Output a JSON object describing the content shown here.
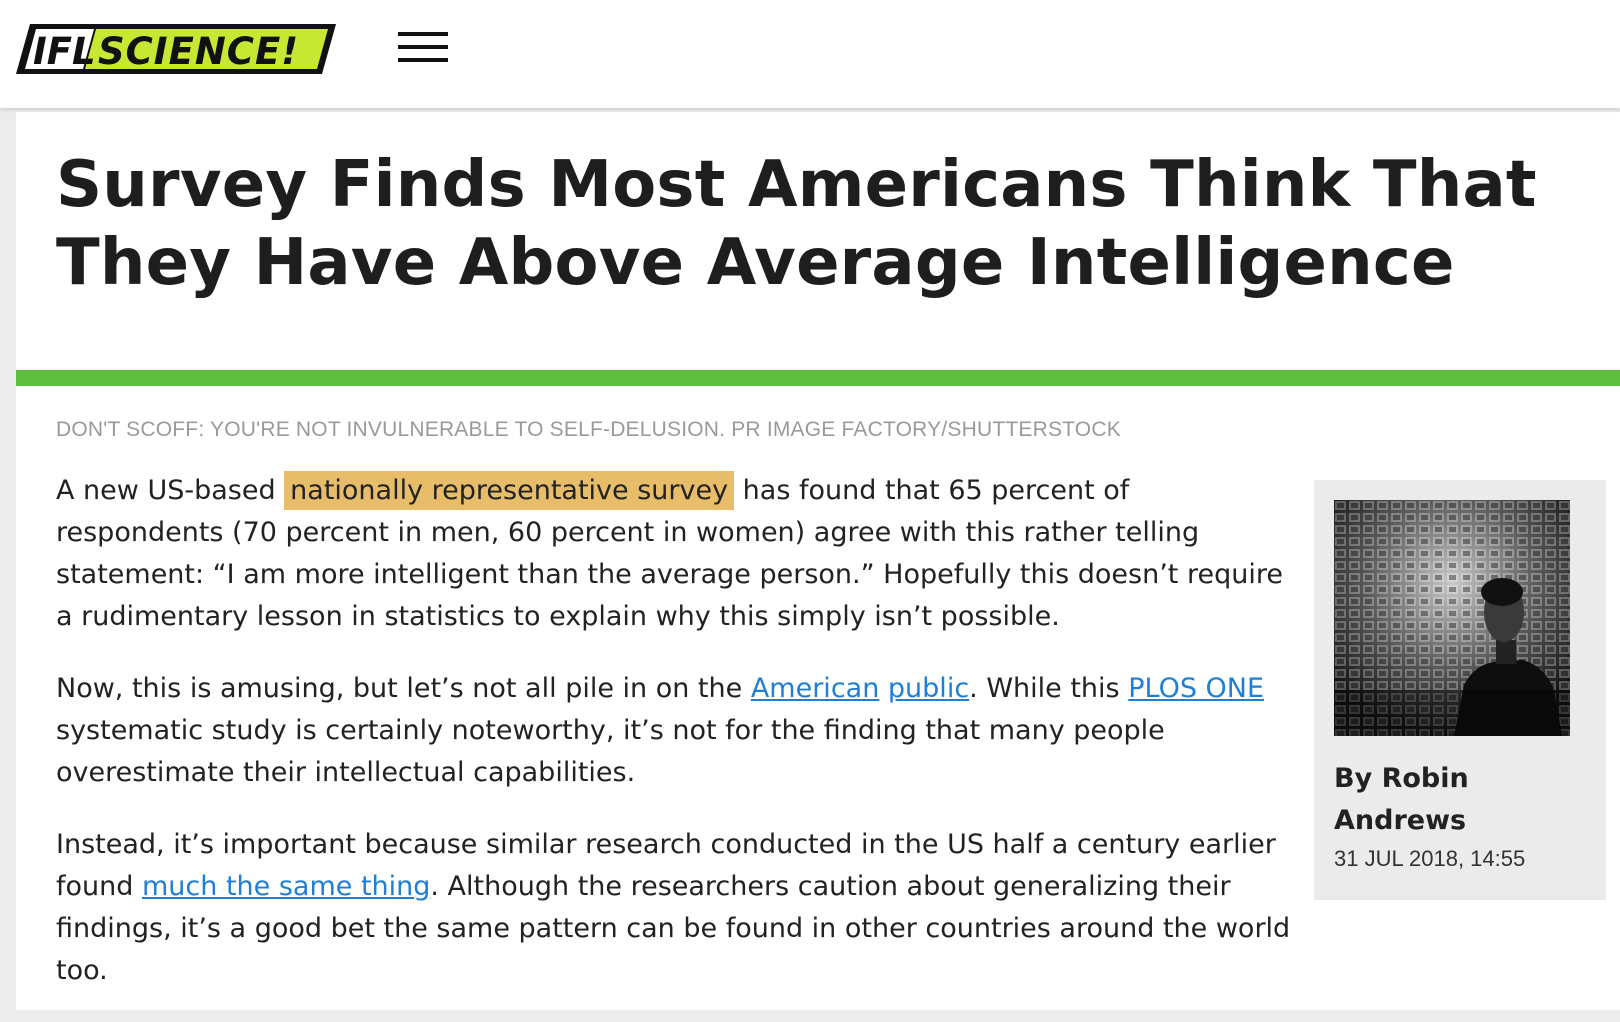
{
  "site": {
    "logo_text": "IFLSCIENCE!",
    "menu_icon": "hamburger-menu-icon",
    "brand_green": "#5cbd3f",
    "logo_lime": "#c6e832"
  },
  "article": {
    "title": "Survey Finds Most Americans Think That They Have Above Average Intelligence",
    "image_caption": "DON'T SCOFF: YOU'RE NOT INVULNERABLE TO SELF-DELUSION. PR IMAGE FACTORY/SHUTTERSTOCK",
    "highlight_color": "#e8bd6a",
    "link_color": "#1f7fd6",
    "p1": {
      "before": "A new US-based ",
      "highlight": "nationally representative survey",
      "after": " has found that 65 percent of respondents (70 percent in men, 60 percent in women) agree with this rather telling statement: “I am more intelligent than the average person.” Hopefully this doesn’t require a rudimentary lesson in statistics to explain why this simply isn’t possible."
    },
    "p2": {
      "text1": "Now, this is amusing, but let’s not all pile in on the ",
      "link1": "American",
      "space": " ",
      "link2": "public",
      "text2": ". While this ",
      "link3": "PLOS ONE",
      "text3": " systematic study is certainly noteworthy, it’s not for the finding that many people overestimate their intellectual capabilities."
    },
    "p3": {
      "text1": "Instead, it’s important because similar research conducted in the US half a century earlier found ",
      "link1": "much the same thing",
      "text2": ". Although the researchers caution about generalizing their findings, it’s a good bet the same pattern can be found in other countries around the world too."
    }
  },
  "author": {
    "byline": "By Robin Andrews",
    "date": "31 JUL 2018, 14:55",
    "photo_icon": "author-photo"
  }
}
